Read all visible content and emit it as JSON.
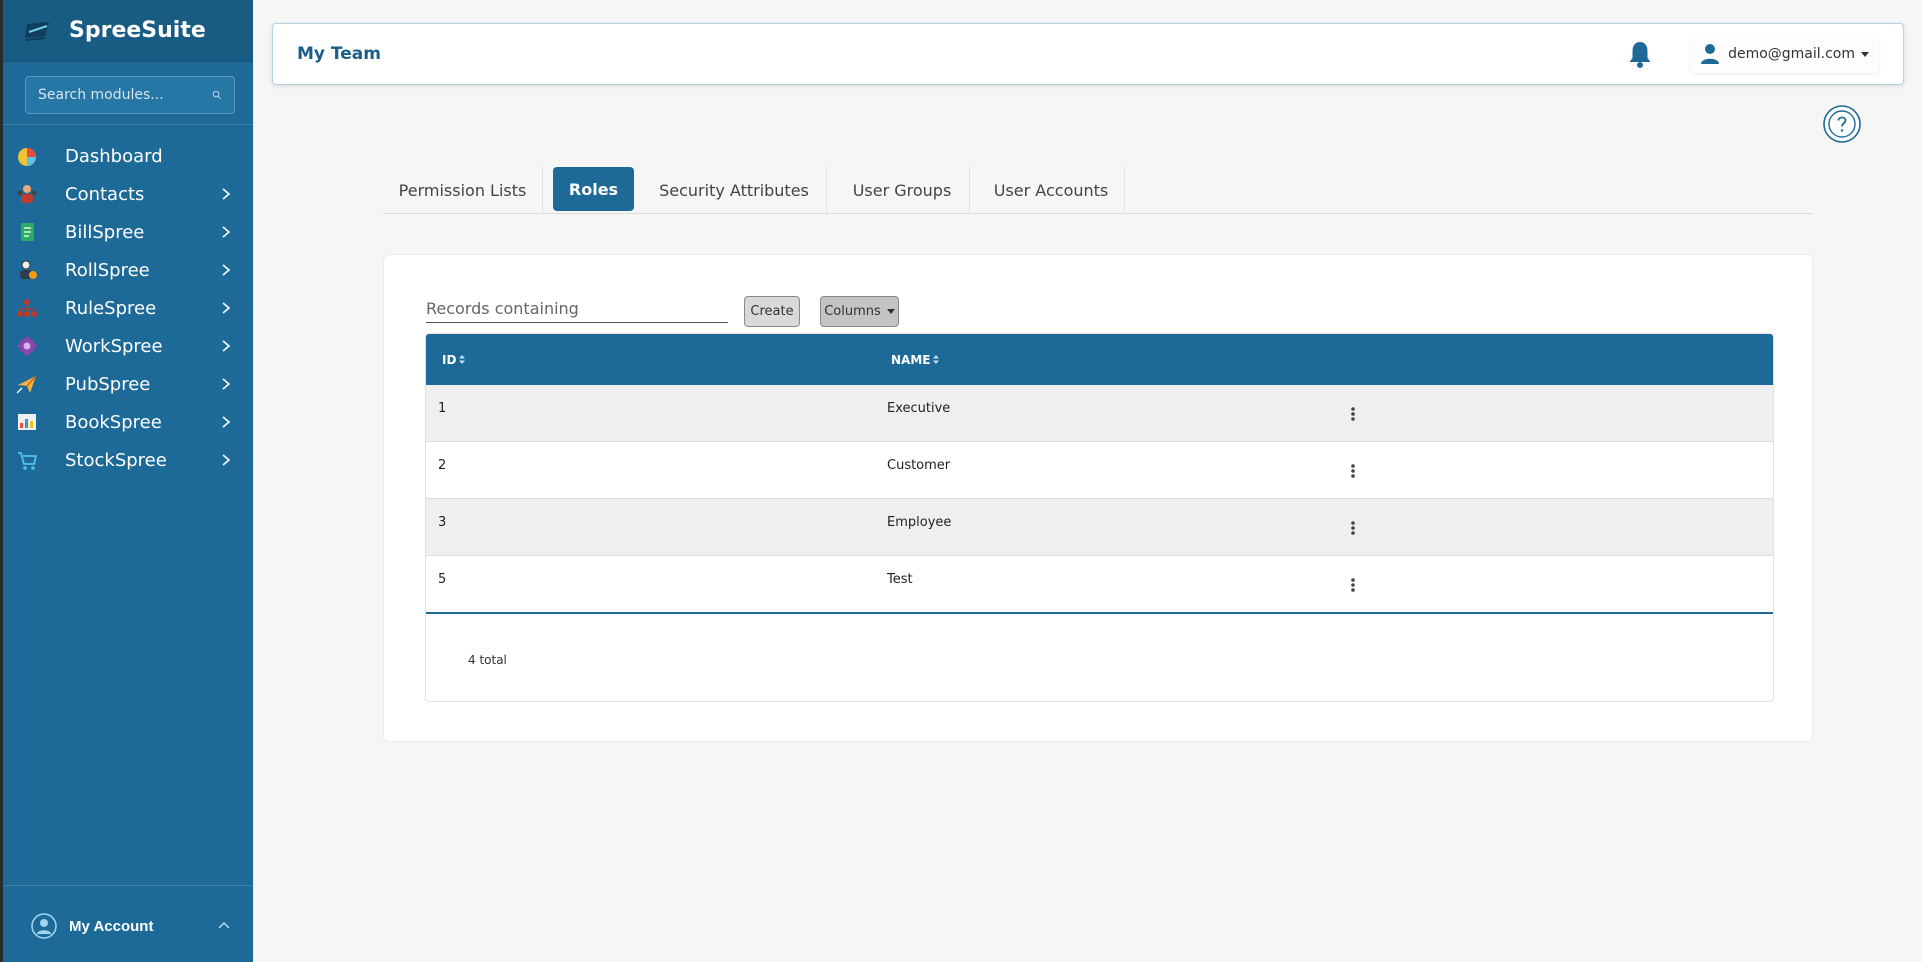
{
  "brand": {
    "name": "SpreeSuite"
  },
  "sidebar": {
    "search_placeholder": "Search modules...",
    "items": [
      {
        "label": "Dashboard",
        "icon": "dashboard-icon",
        "has_submenu": false
      },
      {
        "label": "Contacts",
        "icon": "contacts-icon",
        "has_submenu": true
      },
      {
        "label": "BillSpree",
        "icon": "billspree-icon",
        "has_submenu": true
      },
      {
        "label": "RollSpree",
        "icon": "rollspree-icon",
        "has_submenu": true
      },
      {
        "label": "RuleSpree",
        "icon": "rulespree-icon",
        "has_submenu": true
      },
      {
        "label": "WorkSpree",
        "icon": "workspree-icon",
        "has_submenu": true
      },
      {
        "label": "PubSpree",
        "icon": "pubspree-icon",
        "has_submenu": true
      },
      {
        "label": "BookSpree",
        "icon": "bookspree-icon",
        "has_submenu": true
      },
      {
        "label": "StockSpree",
        "icon": "stockspree-icon",
        "has_submenu": true
      }
    ],
    "account_label": "My Account"
  },
  "header": {
    "title": "My Team",
    "user_email": "demo@gmail.com"
  },
  "tabs": [
    {
      "label": "Permission Lists",
      "active": false
    },
    {
      "label": "Roles",
      "active": true
    },
    {
      "label": "Security Attributes",
      "active": false
    },
    {
      "label": "User Groups",
      "active": false
    },
    {
      "label": "User Accounts",
      "active": false
    }
  ],
  "toolbar": {
    "filter_placeholder": "Records containing",
    "create_label": "Create",
    "columns_label": "Columns"
  },
  "table": {
    "columns": [
      "ID",
      "NAME"
    ],
    "rows": [
      {
        "id": "1",
        "name": "Executive"
      },
      {
        "id": "2",
        "name": "Customer"
      },
      {
        "id": "3",
        "name": "Employee"
      },
      {
        "id": "5",
        "name": "Test"
      }
    ],
    "total": "4 total"
  },
  "colors": {
    "primary": "#1d6a98",
    "sidebar_header": "#185b83",
    "page_bg": "#f6f6f6"
  }
}
